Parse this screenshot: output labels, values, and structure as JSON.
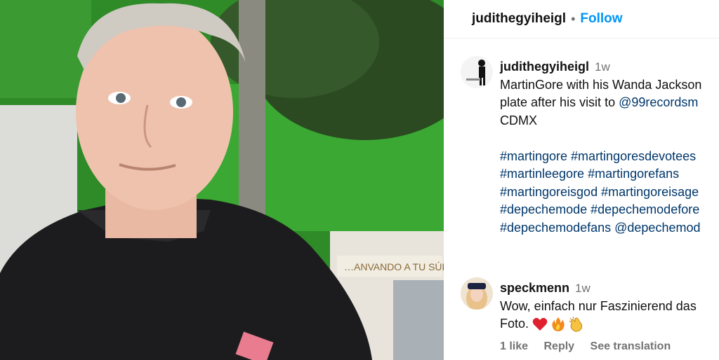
{
  "photo": {
    "alt_icon": "person-photo",
    "sign_text": "…ANVANDO A TU SÚPER"
  },
  "header": {
    "username": "judithegyiheigl",
    "separator": "•",
    "follow_label": "Follow"
  },
  "caption": {
    "username": "judithegyiheigl",
    "time": "1w",
    "line1": "MartinGore with his Wanda Jackson",
    "line2_text": "plate after his visit to ",
    "line2_mention": "@99recordsm",
    "line3": "CDMX",
    "hashtag_lines": [
      "#martingore #martingoresdevotees",
      "#martinleegore #martingorefans",
      "#martingoreisgod #martingoreisage",
      "#depechemode #depechemodefore",
      "#depechemodefans @depechemod"
    ]
  },
  "reply": {
    "username": "speckmenn",
    "time": "1w",
    "line1": "Wow, einfach nur Faszinierend das",
    "line2": "Foto.",
    "emojis": [
      "heart-icon",
      "fire-icon",
      "clapping-hands-icon"
    ],
    "likes": "1 like",
    "reply_label": "Reply",
    "translate_label": "See translation"
  },
  "colors": {
    "follow_blue": "#0095f6",
    "link_blue": "#00376b",
    "muted_gray": "#737373"
  }
}
